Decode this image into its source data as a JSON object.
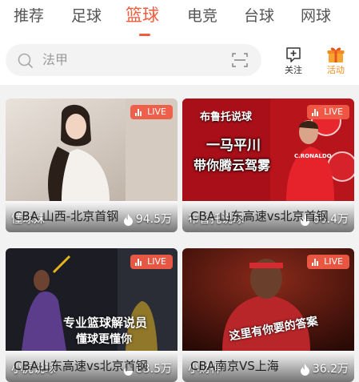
{
  "tabs": [
    {
      "label": "推荐",
      "active": false
    },
    {
      "label": "足球",
      "active": false
    },
    {
      "label": "篮球",
      "active": true
    },
    {
      "label": "电竞",
      "active": false
    },
    {
      "label": "台球",
      "active": false
    },
    {
      "label": "网球",
      "active": false
    }
  ],
  "search": {
    "placeholder": "法甲"
  },
  "toolbar": {
    "follow_label": "关注",
    "activity_label": "活动"
  },
  "colors": {
    "accent": "#f25c3c",
    "activity": "#f28a1e"
  },
  "live_label": "LIVE",
  "cards": [
    {
      "streamer": "懂球妹",
      "heat": "94.5万",
      "title": "CBA 山西-北京首钢",
      "overlay": []
    },
    {
      "streamer": "布鲁托说球",
      "heat": "66.4万",
      "title": "CBA 山东高速vs北京首钢",
      "overlay": [
        "布鲁托说球",
        "一马平川",
        "带你腾云驾雾",
        "C.RONALDO"
      ]
    },
    {
      "streamer": "小虎说球",
      "heat": "83.5万",
      "title": "CBA山东高速vs北京首钢",
      "overlay": [
        "专业篮球解说员",
        "懂球更懂你"
      ]
    },
    {
      "streamer": "小财神",
      "heat": "36.2万",
      "title": "CBA南京VS上海",
      "overlay": [
        "这里有你要的答案"
      ]
    }
  ]
}
